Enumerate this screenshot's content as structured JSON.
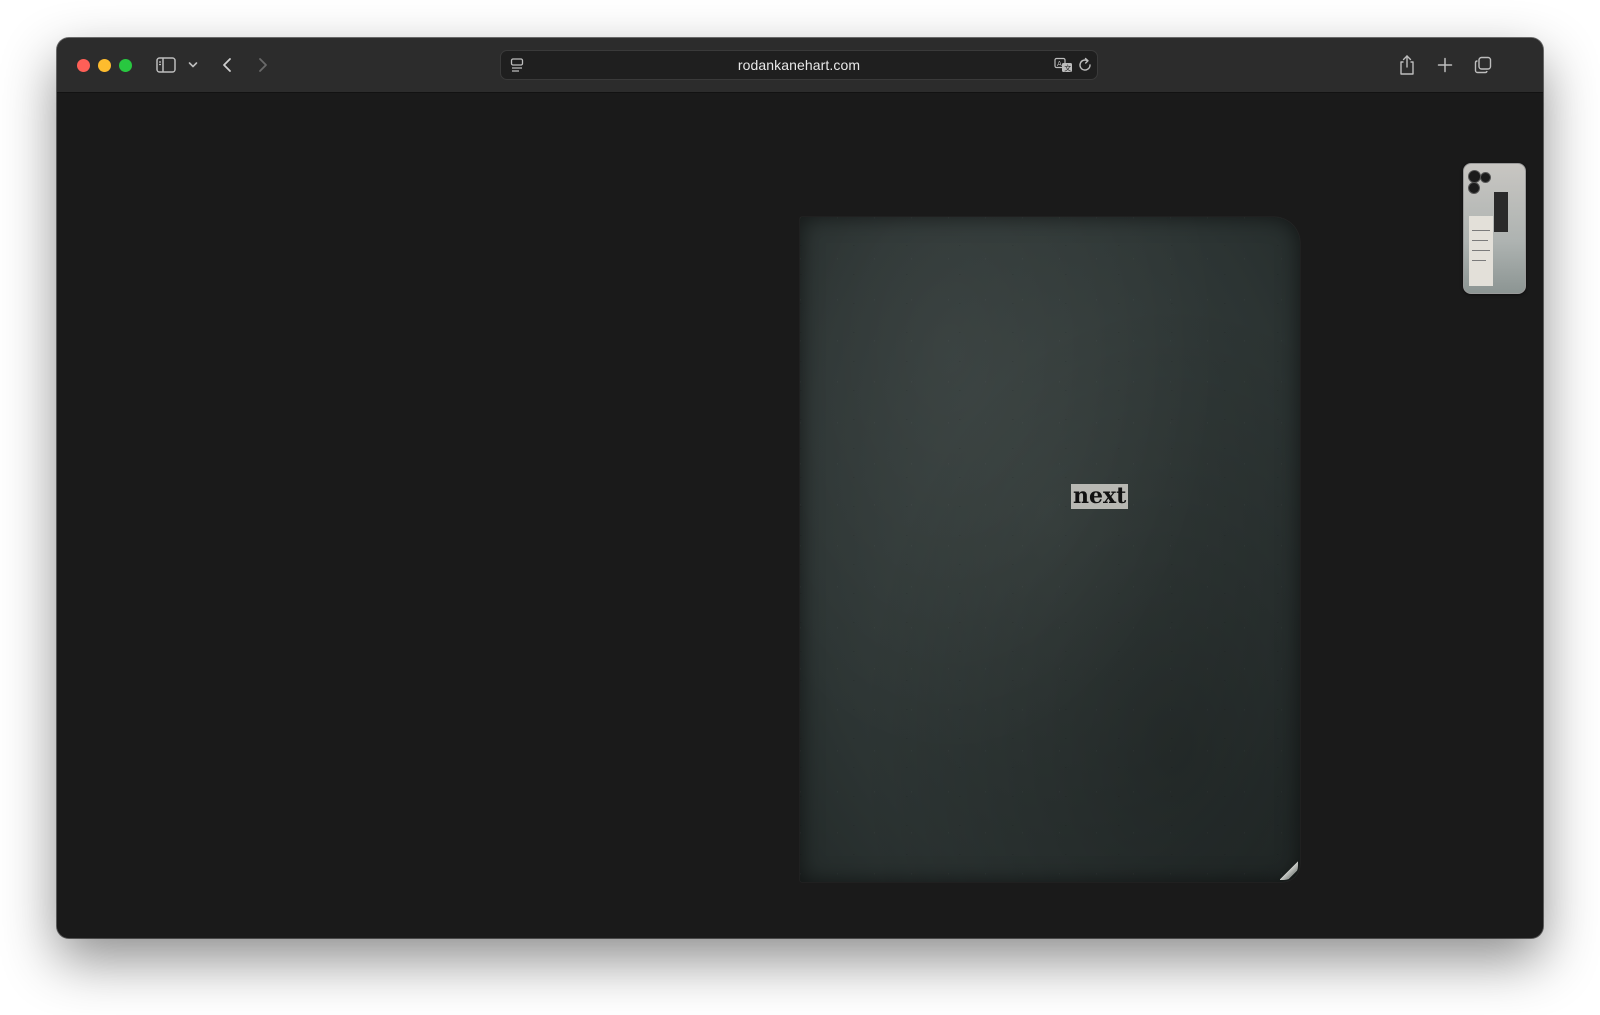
{
  "browser": {
    "url": "rodankanehart.com",
    "icons": {
      "close": "traffic-light-close",
      "minimize": "traffic-light-minimize",
      "maximize": "traffic-light-maximize",
      "sidebar": "sidebar-icon",
      "sidebar_menu": "chevron-down-icon",
      "back": "chevron-left-icon",
      "forward": "chevron-right-icon",
      "page_menu": "page-menu-icon",
      "translate": "translate-icon",
      "reload": "reload-icon",
      "share": "share-icon",
      "new_tab": "plus-icon",
      "tab_overview": "tabs-icon"
    }
  },
  "page": {
    "background_color": "#1a1a1a",
    "notebook": {
      "link_label": "next",
      "cover_color": "#2f3837",
      "label_background": "#b8b8b3"
    },
    "thumbnail": {
      "subject": "phone-photo-thumbnail"
    }
  }
}
